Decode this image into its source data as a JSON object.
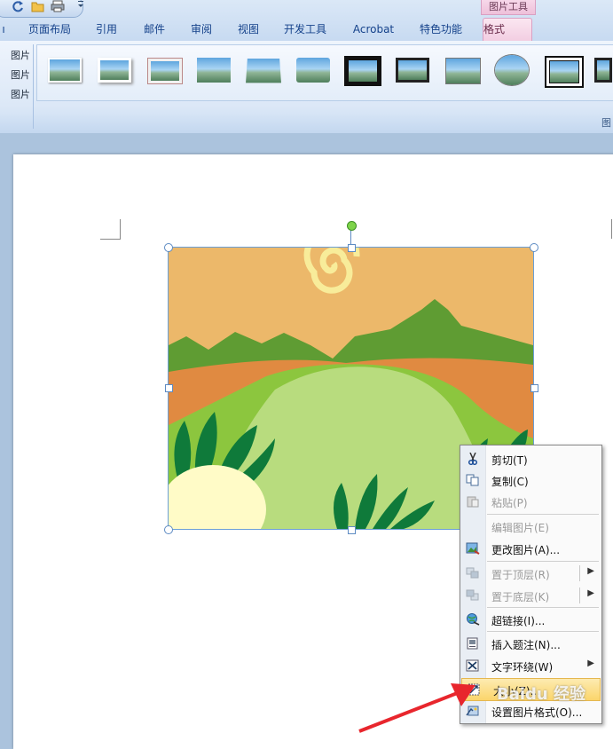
{
  "colors": {
    "ribbon_accent": "#15428b",
    "context_tab": "#f2cde1",
    "menu_highlight": "#fbd56b",
    "arrow": "#e8262d",
    "sun": "#f8ec9a",
    "sky": "#ecb86a",
    "hill_dark": "#5f9c33",
    "field_orange": "#e08a41",
    "field_light": "#b8dc7e",
    "leaf": "#0f7a3a",
    "radish": "#fffbc7"
  },
  "quick_access": {
    "icons": [
      "redo-icon",
      "open-folder-icon",
      "print-icon",
      "customize-chevron-icon"
    ]
  },
  "contextual_group": "图片工具",
  "tabs": [
    {
      "label": "页面布局"
    },
    {
      "label": "引用"
    },
    {
      "label": "邮件"
    },
    {
      "label": "审阅"
    },
    {
      "label": "视图"
    },
    {
      "label": "开发工具"
    },
    {
      "label": "Acrobat"
    },
    {
      "label": "特色功能"
    },
    {
      "label": "格式"
    }
  ],
  "ribbon": {
    "left_items": [
      "图片",
      "图片",
      "图片"
    ],
    "group_label": "图"
  },
  "context_menu": {
    "items": [
      {
        "label": "剪切(T)",
        "icon": "scissors-icon",
        "enabled": true
      },
      {
        "label": "复制(C)",
        "icon": "copy-icon",
        "enabled": true
      },
      {
        "label": "粘贴(P)",
        "icon": "paste-icon",
        "enabled": false
      },
      {
        "label": "编辑图片(E)",
        "icon": "",
        "enabled": false
      },
      {
        "label": "更改图片(A)...",
        "icon": "change-picture-icon",
        "enabled": true
      },
      {
        "label": "置于顶层(R)",
        "icon": "bring-front-icon",
        "enabled": false
      },
      {
        "label": "置于底层(K)",
        "icon": "send-back-icon",
        "enabled": false
      },
      {
        "label": "超链接(I)...",
        "icon": "hyperlink-icon",
        "enabled": true
      },
      {
        "label": "插入题注(N)...",
        "icon": "insert-caption-icon",
        "enabled": true
      },
      {
        "label": "文字环绕(W)",
        "icon": "text-wrap-icon",
        "enabled": true
      },
      {
        "label": "大小(Z)...",
        "icon": "size-icon",
        "enabled": true
      },
      {
        "label": "设置图片格式(O)...",
        "icon": "format-picture-icon",
        "enabled": true
      }
    ]
  },
  "watermark": "Baidu 经验"
}
